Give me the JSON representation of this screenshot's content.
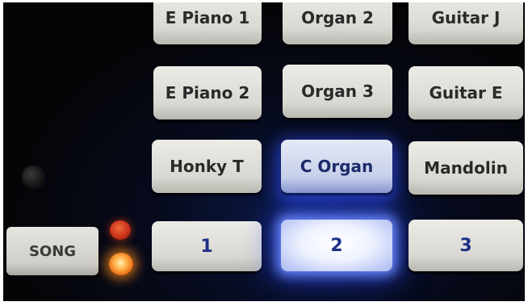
{
  "tone_buttons": [
    {
      "label": "E Piano 1",
      "lit": false
    },
    {
      "label": "Organ 2",
      "lit": false
    },
    {
      "label": "Guitar J",
      "lit": false
    },
    {
      "label": "E Piano 2",
      "lit": false
    },
    {
      "label": "Organ 3",
      "lit": false
    },
    {
      "label": "Guitar E",
      "lit": false
    },
    {
      "label": "Honky T",
      "lit": false
    },
    {
      "label": "C Organ",
      "lit": true
    },
    {
      "label": "Mandolin",
      "lit": false
    }
  ],
  "number_buttons": [
    {
      "label": "1",
      "lit": false
    },
    {
      "label": "2",
      "lit": true
    },
    {
      "label": "3",
      "lit": false
    }
  ],
  "song_button": {
    "label": "SONG"
  },
  "indicators": {
    "upper_led_color": "#c8321a",
    "lower_led_color": "#ffb44a",
    "lower_led_on": true
  },
  "colors": {
    "panel": "#050507",
    "button_face": "#dcdbd5",
    "button_text": "#2a2a2a",
    "number_text": "#1e2f86",
    "backlight": "#3250ff"
  }
}
